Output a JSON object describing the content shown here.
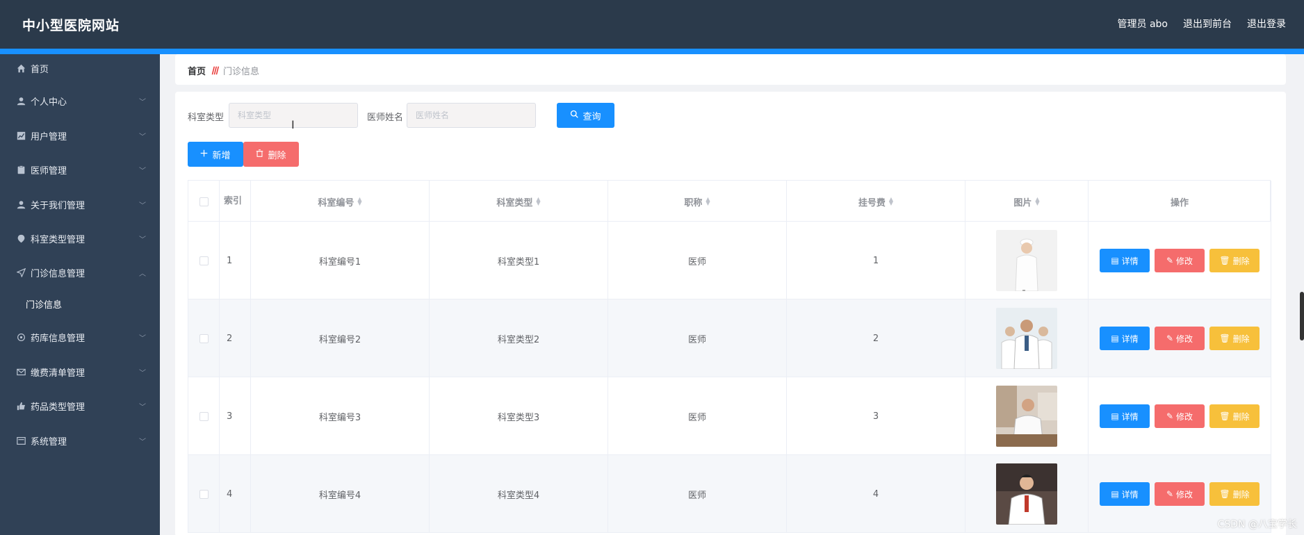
{
  "header": {
    "title": "中小型医院网站",
    "links": [
      "管理员 abo",
      "退出到前台",
      "退出登录"
    ]
  },
  "sidebar": {
    "items": [
      {
        "label": "首页",
        "icon": "home-icon",
        "expandable": false
      },
      {
        "label": "个人中心",
        "icon": "user-icon",
        "expandable": true
      },
      {
        "label": "用户管理",
        "icon": "chart-icon",
        "expandable": true
      },
      {
        "label": "医师管理",
        "icon": "clipboard-icon",
        "expandable": true
      },
      {
        "label": "关于我们管理",
        "icon": "user-icon",
        "expandable": true
      },
      {
        "label": "科室类型管理",
        "icon": "location-icon",
        "expandable": true
      },
      {
        "label": "门诊信息管理",
        "icon": "send-icon",
        "expandable": true,
        "expanded": true
      },
      {
        "label": "门诊信息",
        "sub": true
      },
      {
        "label": "药库信息管理",
        "icon": "gear-icon",
        "expandable": true
      },
      {
        "label": "缴费清单管理",
        "icon": "mail-icon",
        "expandable": true
      },
      {
        "label": "药品类型管理",
        "icon": "thumb-icon",
        "expandable": true
      },
      {
        "label": "系统管理",
        "icon": "window-icon",
        "expandable": true
      }
    ]
  },
  "breadcrumb": {
    "home": "首页",
    "separator": "ꔖ",
    "current": "门诊信息"
  },
  "search": {
    "dept_type_label": "科室类型",
    "dept_type_placeholder": "科室类型",
    "doctor_name_label": "医师姓名",
    "doctor_name_placeholder": "医师姓名",
    "query_label": "查询"
  },
  "actions": {
    "add_label": "新增",
    "delete_label": "删除"
  },
  "table": {
    "columns": [
      "索引",
      "科室编号",
      "科室类型",
      "职称",
      "挂号费",
      "图片",
      "操作"
    ],
    "rows": [
      {
        "index": "1",
        "dept_no": "科室编号1",
        "dept_type": "科室类型1",
        "title": "医师",
        "fee": "1"
      },
      {
        "index": "2",
        "dept_no": "科室编号2",
        "dept_type": "科室类型2",
        "title": "医师",
        "fee": "2"
      },
      {
        "index": "3",
        "dept_no": "科室编号3",
        "dept_type": "科室类型3",
        "title": "医师",
        "fee": "3"
      },
      {
        "index": "4",
        "dept_no": "科室编号4",
        "dept_type": "科室类型4",
        "title": "医师",
        "fee": "4"
      }
    ],
    "row_actions": {
      "detail": "详情",
      "edit": "修改",
      "remove": "删除"
    }
  },
  "watermark": "CSDN @八宝学长",
  "colors": {
    "header": "#2b3a4b",
    "sidebar": "#304156",
    "primary": "#1890ff",
    "danger": "#f56c6c",
    "warning": "#f7c03b"
  }
}
